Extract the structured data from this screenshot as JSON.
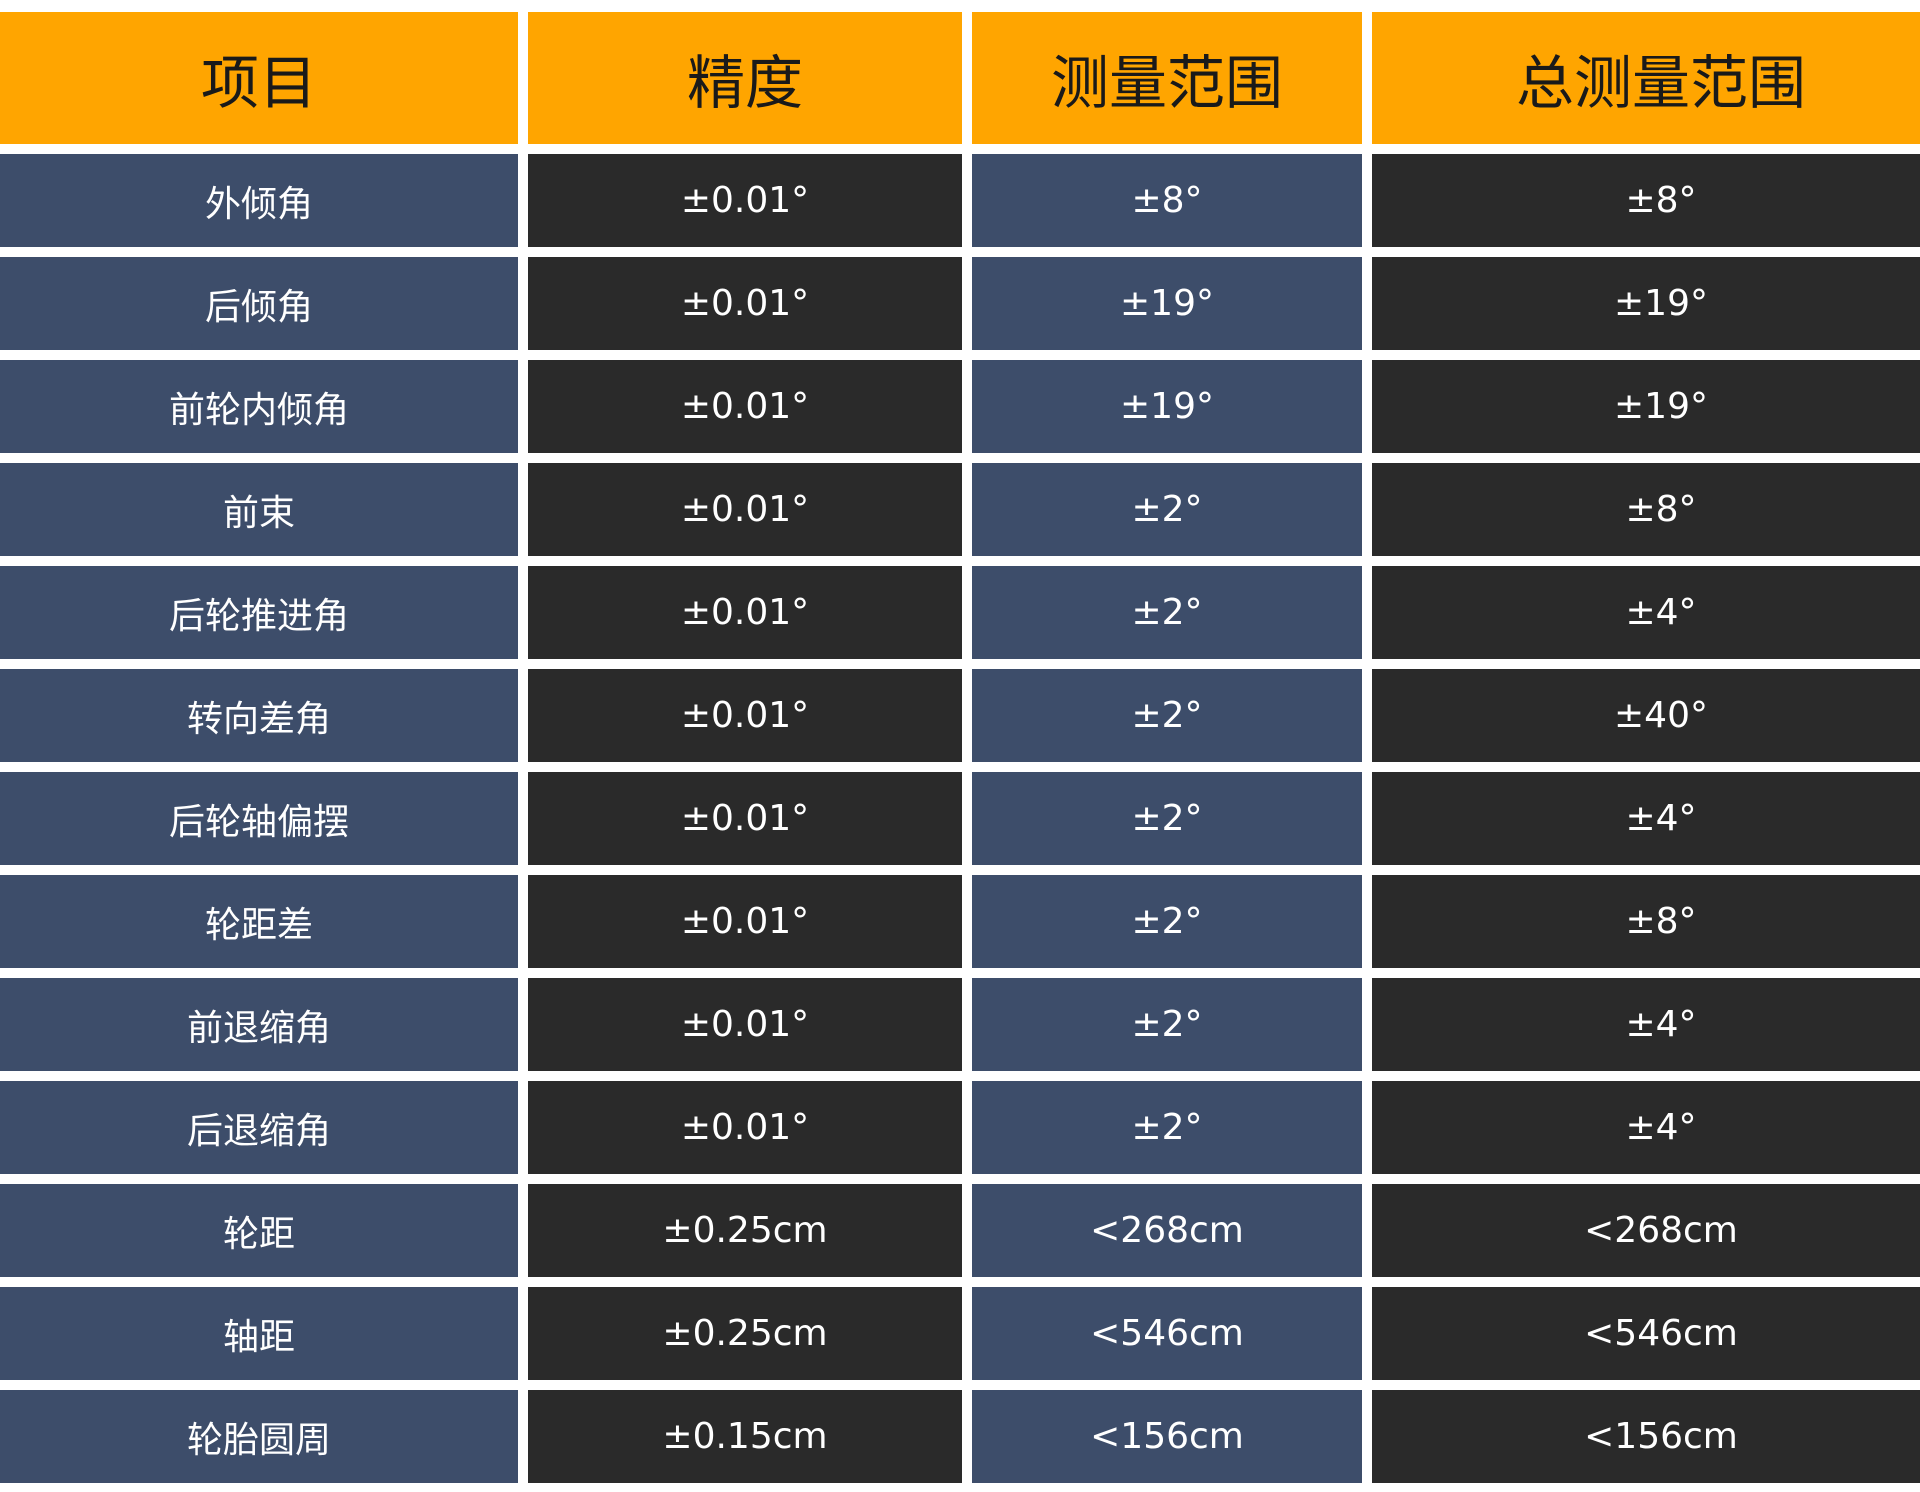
{
  "table": {
    "headers": [
      "项目",
      "精度",
      "测量范围",
      "总测量范围"
    ],
    "rows": [
      [
        "外倾角",
        "±0.01°",
        "±8°",
        "±8°"
      ],
      [
        "后倾角",
        "±0.01°",
        "±19°",
        "±19°"
      ],
      [
        "前轮内倾角",
        "±0.01°",
        "±19°",
        "±19°"
      ],
      [
        "前束",
        "±0.01°",
        "±2°",
        "±8°"
      ],
      [
        "后轮推进角",
        "±0.01°",
        "±2°",
        "±4°"
      ],
      [
        "转向差角",
        "±0.01°",
        "±2°",
        "±40°"
      ],
      [
        "后轮轴偏摆",
        "±0.01°",
        "±2°",
        "±4°"
      ],
      [
        "轮距差",
        "±0.01°",
        "±2°",
        "±8°"
      ],
      [
        "前退缩角",
        "±0.01°",
        "±2°",
        "±4°"
      ],
      [
        "后退缩角",
        "±0.01°",
        "±2°",
        "±4°"
      ],
      [
        "轮距",
        "±0.25cm",
        "<268cm",
        "<268cm"
      ],
      [
        "轴距",
        "±0.25cm",
        "<546cm",
        "<546cm"
      ],
      [
        "轮胎圆周",
        "±0.15cm",
        "<156cm",
        "<156cm"
      ]
    ]
  },
  "colors": {
    "header_bg": "#ffa500",
    "header_text": "#1a1a1a",
    "blue_cell": "#3d4d6a",
    "dark_cell": "#2a2a2a",
    "cell_text": "#ffffff"
  }
}
